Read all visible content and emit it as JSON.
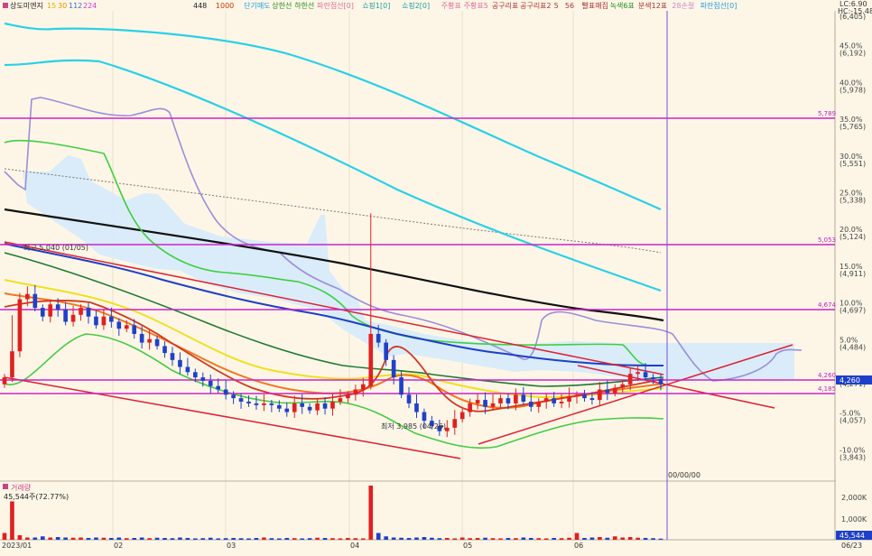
{
  "legend": {
    "title": "상도미엔지",
    "ma_periods": [
      "15",
      "30",
      "112",
      "224"
    ],
    "ma_colors": [
      "#e0b000",
      "#e89500",
      "#3a6fd0",
      "#d13bd1"
    ],
    "right_items": [
      {
        "label": "448",
        "color": "#222222"
      },
      {
        "label": "1000",
        "color": "#cc3300"
      },
      {
        "label": "단기매도",
        "color": "#20a0e0"
      },
      {
        "label": "상한선",
        "color": "#209020"
      },
      {
        "label": "하한선",
        "color": "#209020"
      },
      {
        "label": "파란점선[0]",
        "color": "#e06a9a"
      },
      {
        "label": "쇼핑1[0]",
        "color": "#20a0a0"
      },
      {
        "label": "쇼핑2[0]",
        "color": "#20a0a0"
      },
      {
        "label": "주황표",
        "color": "#e06a9a"
      },
      {
        "label": "주황표5",
        "color": "#e06a9a"
      },
      {
        "label": "공구리표",
        "color": "#b03030"
      },
      {
        "label": "공구리표2",
        "color": "#b03030"
      },
      {
        "label": "5",
        "color": "#b03030"
      },
      {
        "label": "56",
        "color": "#b03030"
      },
      {
        "label": "빨표매집",
        "color": "#b03030"
      },
      {
        "label": "녹색6표",
        "color": "#209020"
      },
      {
        "label": "분색12표",
        "color": "#b03030"
      },
      {
        "label": "28손절",
        "color": "#cc88cc"
      },
      {
        "label": "파란점선[0]",
        "color": "#20a0e0"
      }
    ]
  },
  "corner": {
    "lc": "LC:6.90",
    "hc": "HC:-15.48"
  },
  "price_axis": {
    "ticks": [
      {
        "pct": "",
        "price": "(6,405)"
      },
      {
        "pct": "45.0%",
        "price": "(6,192)"
      },
      {
        "pct": "40.0%",
        "price": "(5,978)"
      },
      {
        "pct": "35.0%",
        "price": "(5,765)"
      },
      {
        "pct": "30.0%",
        "price": "(5,551)"
      },
      {
        "pct": "25.0%",
        "price": "(5,338)"
      },
      {
        "pct": "20.0%",
        "price": "(5,124)"
      },
      {
        "pct": "15.0%",
        "price": "(4,911)"
      },
      {
        "pct": "10.0%",
        "price": "(4,697)"
      },
      {
        "pct": "5.0%",
        "price": "(4,484)"
      },
      {
        "pct": "",
        "price": "(4,271)"
      },
      {
        "pct": "-5.0%",
        "price": "(4,057)"
      },
      {
        "pct": "-10.0%",
        "price": "(3,843)"
      }
    ],
    "current": "4,260"
  },
  "levels": [
    {
      "value": "5,789",
      "color": "#c020c0"
    },
    {
      "value": "5,053",
      "color": "#c020c0"
    },
    {
      "value": "4,674",
      "color": "#c020c0"
    },
    {
      "value": "4,260",
      "color": "#c020c0"
    },
    {
      "value": "4,185",
      "color": "#c020c0"
    }
  ],
  "annotations": {
    "high": "최고 5,040 (01/05)",
    "low": "최저 3,985 (04/26)",
    "future_date": "00/00/00"
  },
  "volume": {
    "title": "거래량",
    "value": "45,544주(72.77%)",
    "ticks": [
      "2,000K",
      "1,000K"
    ],
    "current": "45,544"
  },
  "x_axis": {
    "labels": [
      "2023/01",
      "02",
      "03",
      "04",
      "05",
      "06",
      "06/23"
    ]
  },
  "chart_data": {
    "type": "candlestick",
    "note_units": "KRW",
    "price_range": [
      3843,
      6405
    ],
    "x_labels": [
      "2023/01",
      "02",
      "03",
      "04",
      "05",
      "06",
      "06/23"
    ],
    "high": {
      "value": 5040,
      "date": "01/05"
    },
    "low": {
      "value": 3985,
      "date": "04/26"
    },
    "last_close": 4260,
    "horizontal_levels": [
      5789,
      5053,
      4674,
      4260,
      4185
    ],
    "close_series": [
      4300,
      4450,
      4750,
      4780,
      4700,
      4650,
      4720,
      4690,
      4620,
      4660,
      4700,
      4650,
      4600,
      4650,
      4620,
      4580,
      4600,
      4550,
      4500,
      4520,
      4480,
      4440,
      4400,
      4360,
      4330,
      4300,
      4280,
      4250,
      4230,
      4200,
      4180,
      4160,
      4150,
      4140,
      4150,
      4140,
      4120,
      4100,
      4150,
      4130,
      4110,
      4150,
      4120,
      4160,
      4180,
      4200,
      4230,
      4260,
      4550,
      4500,
      4400,
      4300,
      4200,
      4150,
      4100,
      4050,
      4020,
      3990,
      4010,
      4060,
      4100,
      4150,
      4170,
      4130,
      4150,
      4180,
      4150,
      4200,
      4160,
      4130,
      4160,
      4180,
      4150,
      4160,
      4190,
      4200,
      4180,
      4170,
      4230,
      4210,
      4240,
      4260,
      4320,
      4330,
      4300,
      4290,
      4260
    ],
    "volume_series": [
      0.3,
      1.7,
      0.2,
      0.1,
      0.1,
      0.15,
      0.1,
      0.12,
      0.1,
      0.09,
      0.1,
      0.08,
      0.1,
      0.09,
      0.08,
      0.1,
      0.07,
      0.08,
      0.1,
      0.07,
      0.09,
      0.08,
      0.07,
      0.1,
      0.08,
      0.06,
      0.07,
      0.09,
      0.06,
      0.07,
      0.08,
      0.07,
      0.06,
      0.08,
      0.1,
      0.07,
      0.06,
      0.08,
      0.07,
      0.06,
      0.07,
      0.09,
      0.08,
      0.07,
      0.06,
      0.08,
      0.07,
      0.06,
      2.6,
      0.3,
      0.15,
      0.1,
      0.09,
      0.08,
      0.1,
      0.12,
      0.09,
      0.07,
      0.08,
      0.06,
      0.1,
      0.07,
      0.08,
      0.09,
      0.07,
      0.06,
      0.08,
      0.07,
      0.1,
      0.08,
      0.07,
      0.06,
      0.08,
      0.07,
      0.09,
      0.3,
      0.08,
      0.1,
      0.12,
      0.09,
      0.15,
      0.1,
      0.12,
      0.09,
      0.08,
      0.07,
      0.05
    ]
  }
}
